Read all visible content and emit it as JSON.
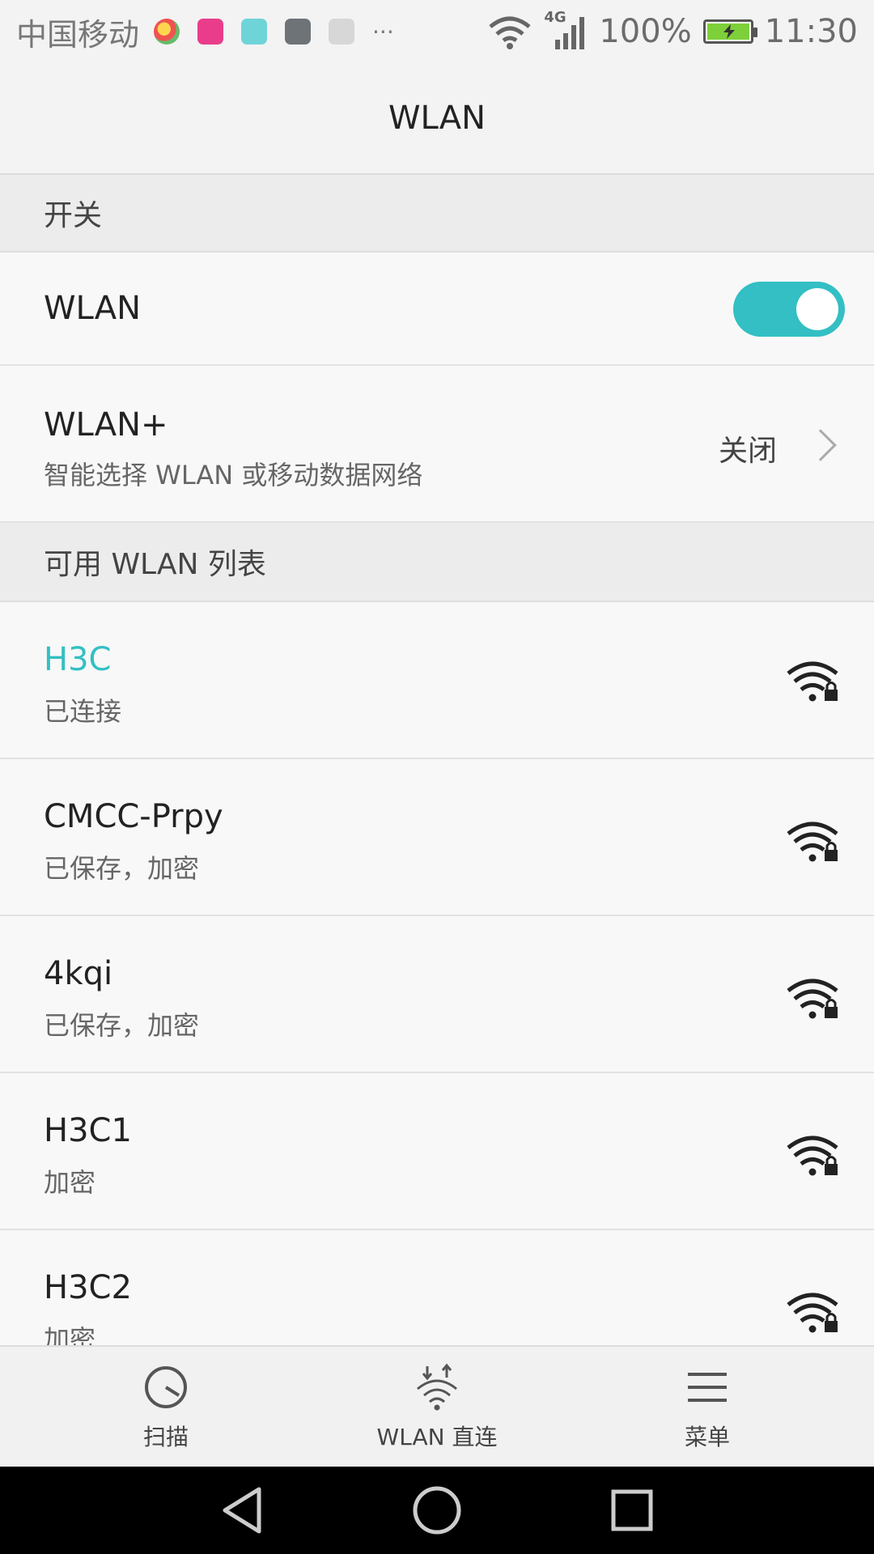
{
  "status_bar": {
    "carrier": "中国移动",
    "network": "4G",
    "battery": "100%",
    "time": "11:30",
    "more": "···"
  },
  "title": "WLAN",
  "sections": {
    "switch_header": "开关",
    "list_header": "可用 WLAN 列表"
  },
  "wlan_toggle": {
    "label": "WLAN",
    "state": "on"
  },
  "wlan_plus": {
    "title": "WLAN+",
    "subtitle": "智能选择 WLAN 或移动数据网络",
    "value": "关闭"
  },
  "networks": [
    {
      "name": "H3C",
      "status": "已连接"
    },
    {
      "name": "CMCC-Prpy",
      "status": "已保存，加密"
    },
    {
      "name": "4kqi",
      "status": "已保存，加密"
    },
    {
      "name": "H3C1",
      "status": "加密"
    },
    {
      "name": "H3C2",
      "status": "加密"
    }
  ],
  "bottom_tabs": {
    "scan": "扫描",
    "direct": "WLAN 直连",
    "menu": "菜单"
  },
  "colors": {
    "accent": "#33bfc4",
    "text": "#222222",
    "secondary_text": "#666666"
  }
}
